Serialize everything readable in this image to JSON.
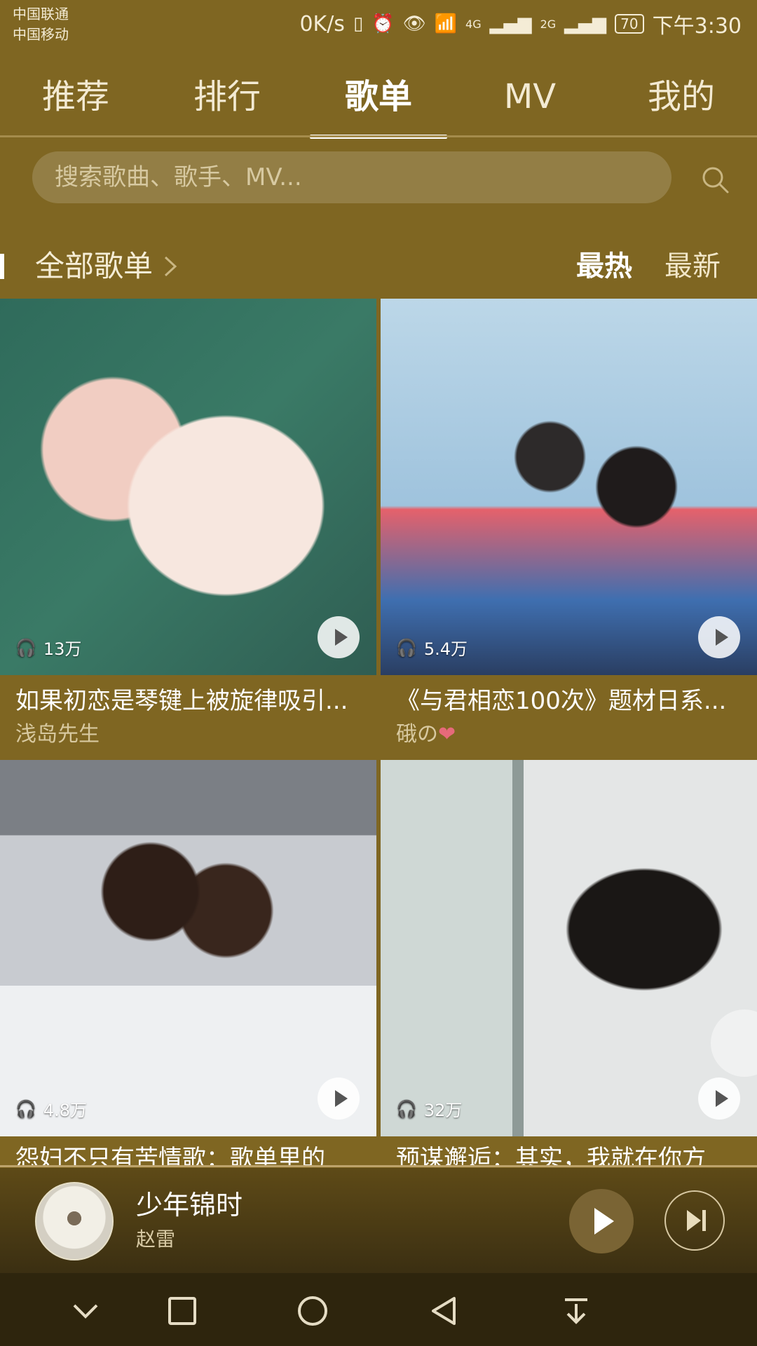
{
  "status_bar": {
    "carrier_1": "中国联通",
    "carrier_2": "中国移动",
    "net_speed": "0K/s",
    "signal_4g": "4G",
    "signal_2g": "2G",
    "battery": "70",
    "time": "下午3:30"
  },
  "tabs": [
    {
      "label": "推荐"
    },
    {
      "label": "排行"
    },
    {
      "label": "歌单",
      "active": true
    },
    {
      "label": "MV"
    },
    {
      "label": "我的"
    }
  ],
  "search": {
    "placeholder": "搜索歌曲、歌手、MV..."
  },
  "section": {
    "title": "全部歌单",
    "sort_hot": "最热",
    "sort_new": "最新"
  },
  "playlists": [
    {
      "title": "如果初恋是琴键上被旋律吸引...",
      "author": "浅岛先生",
      "plays": "13万"
    },
    {
      "title": "《与君相恋100次》题材日系...",
      "author": "硪の",
      "plays": "5.4万"
    },
    {
      "title": "怨妇不只有苦情歌：歌单里的",
      "plays": "4.8万"
    },
    {
      "title": "预谋邂逅：其实，我就在你方",
      "plays": "32万"
    }
  ],
  "player": {
    "song": "少年锦时",
    "artist": "赵雷"
  },
  "colors": {
    "background": "#7f6622",
    "player_bg": "#4a3b14",
    "nav_bg": "#2e250d"
  }
}
